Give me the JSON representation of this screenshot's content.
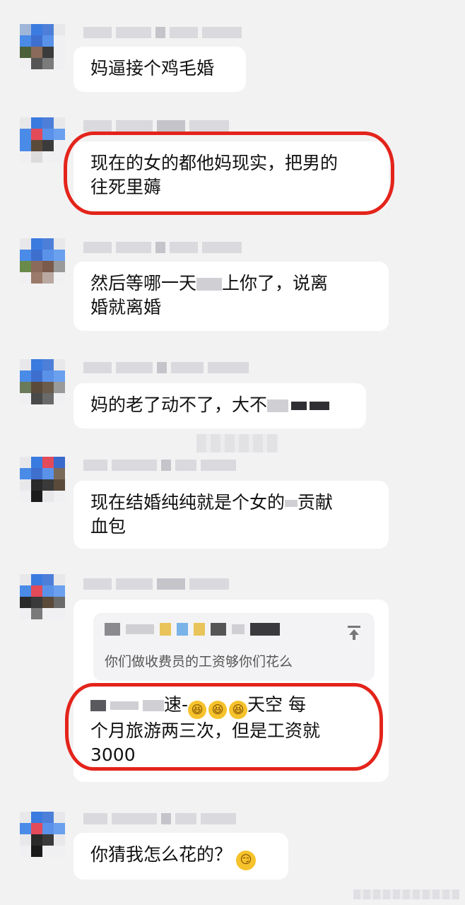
{
  "messages": [
    {
      "id": "m1",
      "text": "妈逼接个鸡毛婚"
    },
    {
      "id": "m2",
      "line1": "现在的女的都他妈现实，把男的",
      "line2": "往死里薅"
    },
    {
      "id": "m3",
      "line1_a": "然后等哪一天",
      "line1_b": "上你了，说离",
      "line2": "婚就离婚"
    },
    {
      "id": "m4",
      "text_a": "妈的老了动不了，大不"
    },
    {
      "id": "m5",
      "line1_a": "现在结婚纯纯就是个女的",
      "line1_b": "贡献",
      "line2": "血包"
    },
    {
      "id": "m6",
      "quote": "你们做收费员的工资够你们花么",
      "line1_a": "速-",
      "line1_b": "天空 每",
      "line2": "个月旅游两三次，但是工资就",
      "line3": "3000"
    },
    {
      "id": "m7",
      "text": "你猜我怎么花的？"
    }
  ],
  "icons": {
    "quote": "pin-to-top-icon",
    "laugh": "rolling-on-floor-laughing-emoji",
    "smirk": "smirking-face-emoji"
  },
  "colors": {
    "annotation_ring": "#e3241b",
    "bubble": "#ffffff",
    "background": "#f2f2f3"
  }
}
